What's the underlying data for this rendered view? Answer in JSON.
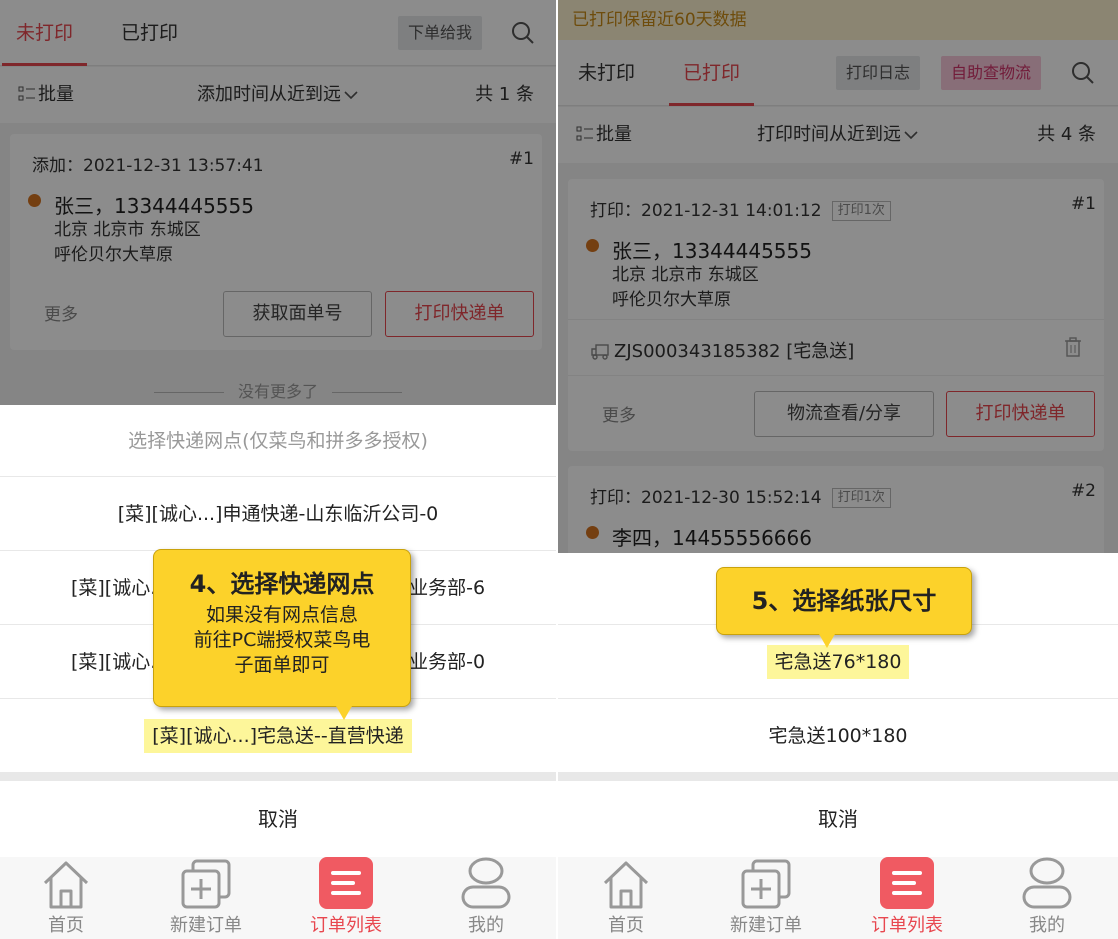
{
  "left": {
    "tabs": [
      "未打印",
      "已打印"
    ],
    "order_to_me": "下单给我",
    "toolbar": {
      "batch": "批量",
      "sort": "添加时间从近到远",
      "count": "共 1 条"
    },
    "card": {
      "added": "添加：2021-12-31 13:57:41",
      "num": "#1",
      "recipient": "张三，13344445555",
      "addr1": "北京 北京市 东城区",
      "addr2": "呼伦贝尔大草原",
      "more": "更多",
      "get_waybill": "获取面单号",
      "print": "打印快递单"
    },
    "no_more": "没有更多了",
    "sheet": {
      "title": "选择快递网点(仅菜鸟和拼多多授权)",
      "options": [
        "[菜][诚心...]申通快递-山东临沂公司-0",
        "[菜][诚心...]■■■■■■■■■■■■■业务部-6",
        "[菜][诚心...]■■■■■■■■■■■■■业务部-0",
        "[菜][诚心...]宅急送--直营快递"
      ],
      "cancel": "取消"
    },
    "callout": {
      "title": "4、选择快递网点",
      "line1": "如果没有网点信息",
      "line2": "前往PC端授权菜鸟电",
      "line3": "子面单即可"
    }
  },
  "right": {
    "banner": "已打印保留近60天数据",
    "tabs": [
      "未打印",
      "已打印"
    ],
    "print_log": "打印日志",
    "self_track": "自助查物流",
    "toolbar": {
      "batch": "批量",
      "sort": "打印时间从近到远",
      "count": "共 4 条"
    },
    "card1": {
      "printed": "打印：2021-12-31 14:01:12",
      "badge": "打印1次",
      "num": "#1",
      "recipient": "张三，13344445555",
      "addr1": "北京 北京市 东城区",
      "addr2": "呼伦贝尔大草原",
      "tracking": "ZJS000343185382 [宅急送]",
      "more": "更多",
      "logistics": "物流查看/分享",
      "print": "打印快递单"
    },
    "card2": {
      "printed": "打印：2021-12-30 15:52:14",
      "badge": "打印1次",
      "num": "#2",
      "recipient": "李四，14455556666"
    },
    "sheet": {
      "options": [
        "宅急送76*180",
        "宅急送100*180"
      ],
      "cancel": "取消"
    },
    "callout": {
      "title": "5、选择纸张尺寸"
    }
  },
  "tabbar": [
    "首页",
    "新建订单",
    "订单列表",
    "我的"
  ],
  "colors": {
    "accent": "#e8474f",
    "callout": "#fcd22a",
    "highlight": "#fdf69a"
  }
}
